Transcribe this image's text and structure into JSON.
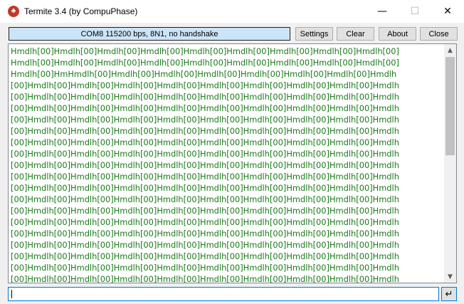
{
  "window": {
    "title": "Termite 3.4 (by CompuPhase)",
    "app_icon_glyph": "♣",
    "minimize_glyph": "—",
    "maximize_glyph": "☐",
    "close_glyph": "✕"
  },
  "toolbar": {
    "status": "COM8 115200 bps, 8N1, no handshake",
    "settings_label": "Settings",
    "clear_label": "Clear",
    "about_label": "About",
    "close_label": "Close"
  },
  "output": {
    "text_color": "#1a7a1a",
    "lines": [
      "Hmdlh[00]Hmdlh[00]Hmdlh[00]Hmdlh[00]Hmdlh[00]Hmdlh[00]Hmdlh[00]Hmdlh[00]Hmdlh[00]",
      "Hmdlh[00]Hmdlh[00]Hmdlh[00]Hmdlh[00]Hmdlh[00]Hmdlh[00]Hmdlh[00]Hmdlh[00]Hmdlh[00]",
      "Hmdlh[00]HmHmdlh[00]Hmdlh[00]Hmdlh[00]Hmdlh[00]Hmdlh[00]Hmdlh[00]Hmdlh[00]Hmdlh",
      "[00]Hmdlh[00]Hmdlh[00]Hmdlh[00]Hmdlh[00]Hmdlh[00]Hmdlh[00]Hmdlh[00]Hmdlh[00]Hmdlh",
      "[00]Hmdlh[00]Hmdlh[00]Hmdlh[00]Hmdlh[00]Hmdlh[00]Hmdlh[00]Hmdlh[00]Hmdlh[00]Hmdlh",
      "[00]Hmdlh[00]Hmdlh[00]Hmdlh[00]Hmdlh[00]Hmdlh[00]Hmdlh[00]Hmdlh[00]Hmdlh[00]Hmdlh",
      "[00]Hmdlh[00]Hmdlh[00]Hmdlh[00]Hmdlh[00]Hmdlh[00]Hmdlh[00]Hmdlh[00]Hmdlh[00]Hmdlh",
      "[00]Hmdlh[00]Hmdlh[00]Hmdlh[00]Hmdlh[00]Hmdlh[00]Hmdlh[00]Hmdlh[00]Hmdlh[00]Hmdlh",
      "[00]Hmdlh[00]Hmdlh[00]Hmdlh[00]Hmdlh[00]Hmdlh[00]Hmdlh[00]Hmdlh[00]Hmdlh[00]Hmdlh",
      "[00]Hmdlh[00]Hmdlh[00]Hmdlh[00]Hmdlh[00]Hmdlh[00]Hmdlh[00]Hmdlh[00]Hmdlh[00]Hmdlh",
      "[00]Hmdlh[00]Hmdlh[00]Hmdlh[00]Hmdlh[00]Hmdlh[00]Hmdlh[00]Hmdlh[00]Hmdlh[00]Hmdlh",
      "[00]Hmdlh[00]Hmdlh[00]Hmdlh[00]Hmdlh[00]Hmdlh[00]Hmdlh[00]Hmdlh[00]Hmdlh[00]Hmdlh",
      "[00]Hmdlh[00]Hmdlh[00]Hmdlh[00]Hmdlh[00]Hmdlh[00]Hmdlh[00]Hmdlh[00]Hmdlh[00]Hmdlh",
      "[00]Hmdlh[00]Hmdlh[00]Hmdlh[00]Hmdlh[00]Hmdlh[00]Hmdlh[00]Hmdlh[00]Hmdlh[00]Hmdlh",
      "[00]Hmdlh[00]Hmdlh[00]Hmdlh[00]Hmdlh[00]Hmdlh[00]Hmdlh[00]Hmdlh[00]Hmdlh[00]Hmdlh",
      "[00]Hmdlh[00]Hmdlh[00]Hmdlh[00]Hmdlh[00]Hmdlh[00]Hmdlh[00]Hmdlh[00]Hmdlh[00]Hmdlh",
      "[00]Hmdlh[00]Hmdlh[00]Hmdlh[00]Hmdlh[00]Hmdlh[00]Hmdlh[00]Hmdlh[00]Hmdlh[00]Hmdlh",
      "[00]Hmdlh[00]Hmdlh[00]Hmdlh[00]Hmdlh[00]Hmdlh[00]Hmdlh[00]Hmdlh[00]Hmdlh[00]Hmdlh",
      "[00]Hmdlh[00]Hmdlh[00]Hmdlh[00]Hmdlh[00]Hmdlh[00]Hmdlh[00]Hmdlh[00]Hmdlh[00]Hmdlh",
      "[00]Hmdlh[00]Hmdlh[00]Hmdlh[00]Hmdlh[00]Hmdlh[00]Hmdlh[00]Hmdlh[00]Hmdlh[00]Hmdlh",
      "[00]Hmdlh[00]Hmdlh[00]Hmdlh[00]Hmdlh[00]Hmdlh[00]Hmdlh[00]Hmdlh[00]Hmdlh[00]Hmdlh"
    ]
  },
  "scrollbar": {
    "up_glyph": "▲",
    "down_glyph": "▼"
  },
  "input": {
    "value": "",
    "send_glyph": "↵"
  }
}
